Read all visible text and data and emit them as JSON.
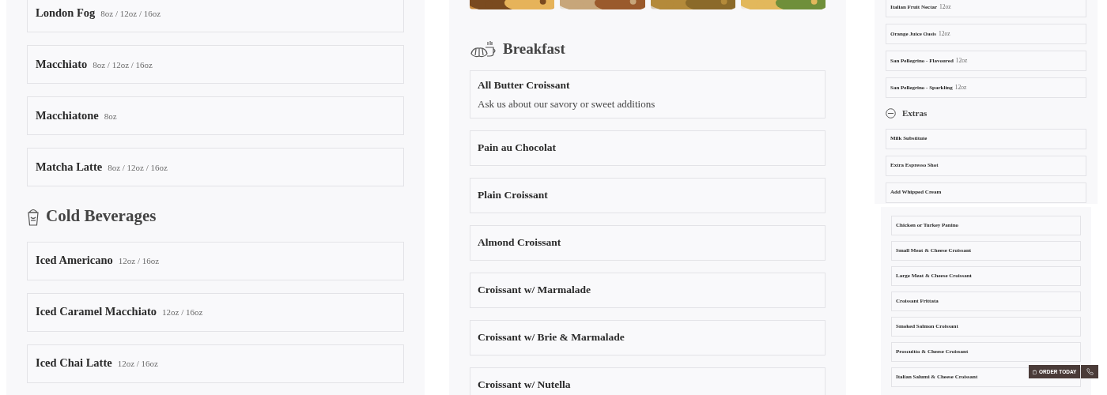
{
  "left_column": {
    "sections": [
      {
        "items": [
          {
            "name": "London Fog",
            "sizes": "8oz / 12oz / 16oz"
          },
          {
            "name": "Macchiato",
            "sizes": "8oz / 12oz / 16oz"
          },
          {
            "name": "Macchiatone",
            "sizes": "8oz"
          },
          {
            "name": "Matcha Latte",
            "sizes": "8oz / 12oz / 16oz"
          }
        ]
      },
      {
        "heading": "Cold Beverages",
        "items": [
          {
            "name": "Iced Americano",
            "sizes": "12oz / 16oz"
          },
          {
            "name": "Iced Caramel Macchiato",
            "sizes": "12oz / 16oz"
          },
          {
            "name": "Iced Chai Latte",
            "sizes": "12oz / 16oz"
          }
        ]
      }
    ]
  },
  "middle_column": {
    "sections": [
      {
        "heading": "Breakfast",
        "items": [
          {
            "name": "All Butter Croissant",
            "description": "Ask us about our savory or sweet additions"
          },
          {
            "name": "Pain au Chocolat"
          },
          {
            "name": "Plain Croissant"
          },
          {
            "name": "Almond Croissant"
          },
          {
            "name": "Croissant w/ Marmalade"
          },
          {
            "name": "Croissant w/ Brie & Marmalade"
          },
          {
            "name": "Croissant w/ Nutella"
          }
        ]
      }
    ]
  },
  "right_column": {
    "panels": [
      {
        "sections": [
          {
            "items": [
              {
                "name": "Italian Fruit Nectar",
                "sizes": "12oz"
              },
              {
                "name": "Orange Juice Oasis",
                "sizes": "12oz"
              },
              {
                "name": "San Pellegrino - Flavoured",
                "sizes": "12oz"
              },
              {
                "name": "San Pellegrino - Sparkling",
                "sizes": "12oz"
              }
            ]
          },
          {
            "heading": "Extras",
            "items": [
              {
                "name": "Milk Substitute"
              },
              {
                "name": "Extra Espresso Shot"
              },
              {
                "name": "Add Whipped Cream"
              }
            ]
          }
        ]
      },
      {
        "sections": [
          {
            "items": [
              {
                "name": "Chicken or Turkey Panino"
              },
              {
                "name": "Small Meat & Cheese Croissant"
              },
              {
                "name": "Large Meat & Cheese Croissant"
              },
              {
                "name": "Croissant Frittata"
              },
              {
                "name": "Smoked Salmon Croissant"
              },
              {
                "name": "Proscuitto & Cheese Croissant"
              },
              {
                "name": "Italian Salumi & Cheese Croissant"
              }
            ]
          }
        ]
      }
    ]
  },
  "floating_actions": [
    {
      "kind": "order",
      "label": "ORDER TODAY"
    },
    {
      "kind": "phone"
    }
  ]
}
